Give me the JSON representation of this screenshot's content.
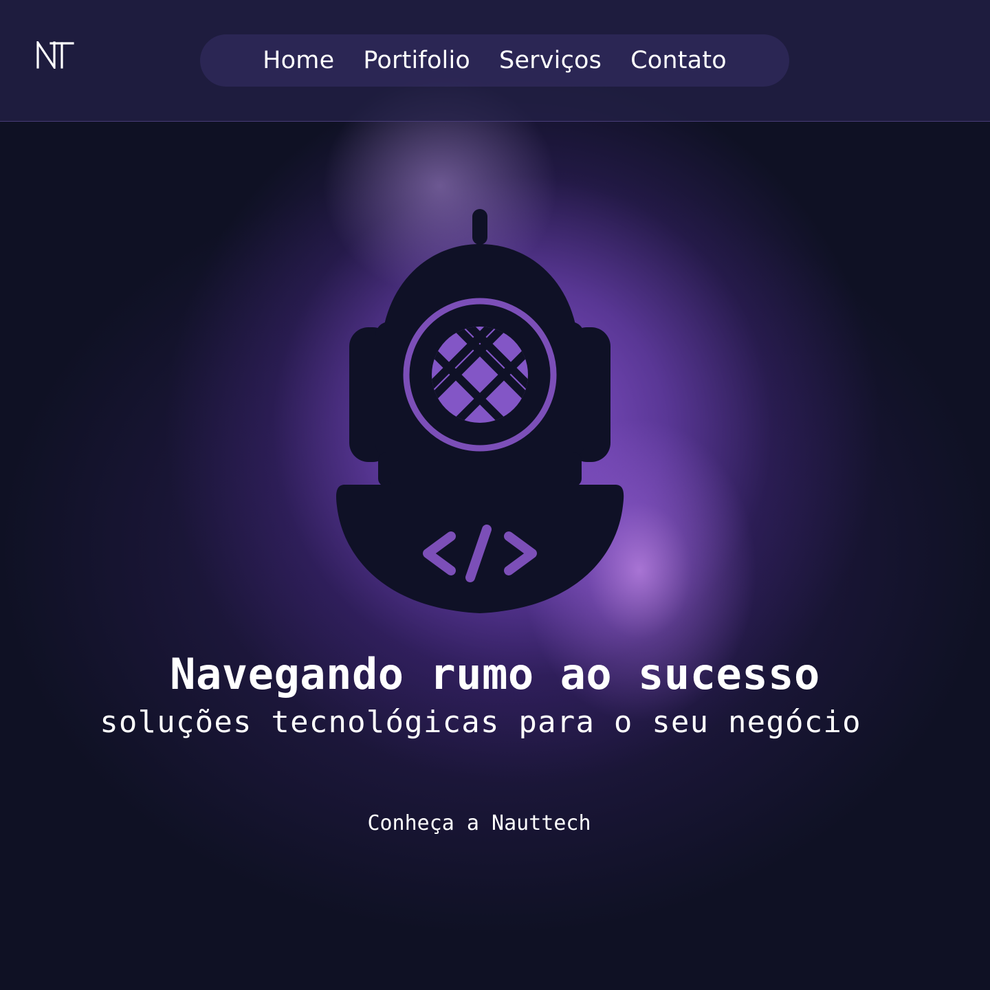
{
  "brand": {
    "logo_text": "NT",
    "accent_color": "#8c56d2",
    "background_color": "#0f1124",
    "mascot_color": "#0f1126"
  },
  "nav": {
    "items": [
      {
        "label": "Home"
      },
      {
        "label": "Portifolio"
      },
      {
        "label": "Serviços"
      },
      {
        "label": "Contato"
      }
    ]
  },
  "hero": {
    "title": "Navegando rumo ao sucesso",
    "subtitle": "soluções tecnológicas para o seu negócio",
    "cta_label": "Conheça a Nauttech",
    "mascot_icon": "diving-helmet-icon",
    "code_glyph": "</>"
  }
}
